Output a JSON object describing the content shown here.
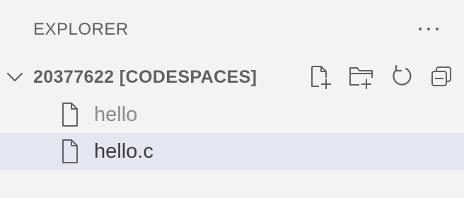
{
  "explorer": {
    "title": "EXPLORER",
    "more_actions_icon": "ellipsis-icon"
  },
  "workspace": {
    "name": "20377622 [CODESPACES]",
    "expanded": true,
    "actions": [
      {
        "name": "new-file",
        "icon": "new-file-icon"
      },
      {
        "name": "new-folder",
        "icon": "new-folder-icon"
      },
      {
        "name": "refresh",
        "icon": "refresh-icon"
      },
      {
        "name": "collapse-all",
        "icon": "collapse-all-icon"
      }
    ]
  },
  "files": [
    {
      "name": "hello",
      "icon": "file-icon",
      "dimmed": true,
      "selected": false
    },
    {
      "name": "hello.c",
      "icon": "file-icon",
      "dimmed": false,
      "selected": true
    }
  ],
  "colors": {
    "background": "#f3f3f3",
    "selected_row": "#e4e6f1",
    "foreground": "#616161"
  }
}
